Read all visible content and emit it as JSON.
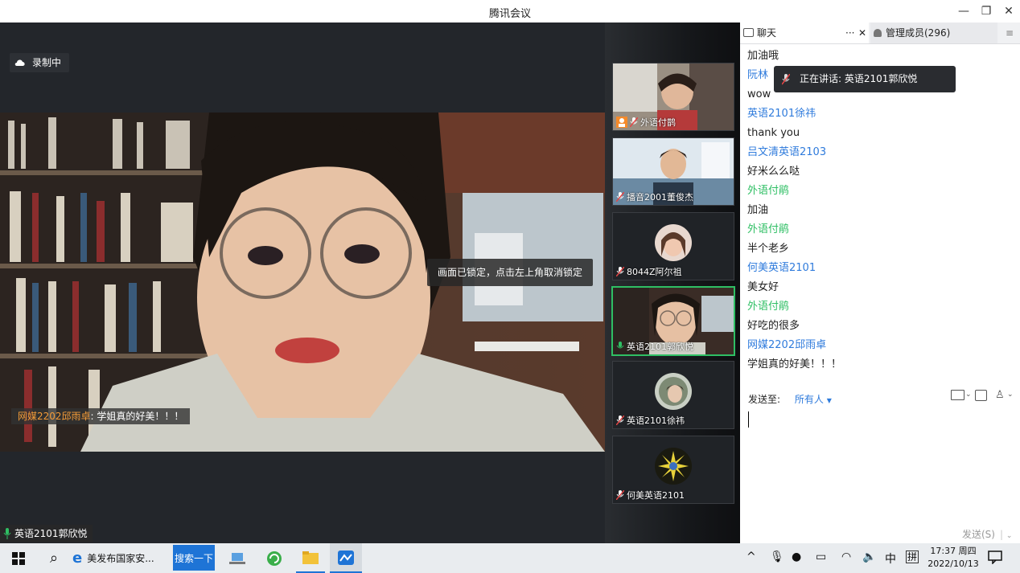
{
  "window": {
    "title": "腾讯会议"
  },
  "video": {
    "recording_label": "录制中",
    "lock_tip": "画面已锁定，点击左上角取消锁定",
    "danmu_name": "网媒2202邱雨卓",
    "danmu_sep": ": ",
    "danmu_text": "学姐真的好美！！！",
    "speaker_name": "英语2101郭欣悦"
  },
  "participants": [
    {
      "name": "外语付鹊"
    },
    {
      "name": "播音2001董俊杰"
    },
    {
      "name": "8044Z阿尔祖"
    },
    {
      "name": "英语2101郭欣悦"
    },
    {
      "name": "英语2101徐祎"
    },
    {
      "name": "何美英语2101"
    }
  ],
  "chat": {
    "tab_label": "聊天",
    "members_label": "管理成员(296)",
    "messages": [
      {
        "kind": "text",
        "value": "加油哦"
      },
      {
        "kind": "sender",
        "value": "阮林"
      },
      {
        "kind": "text",
        "value": "wow"
      },
      {
        "kind": "sender",
        "value": "英语2101徐祎"
      },
      {
        "kind": "text",
        "value": "thank you"
      },
      {
        "kind": "sender",
        "value": "吕文清英语2103"
      },
      {
        "kind": "text",
        "value": "好米么么哒"
      },
      {
        "kind": "sender-green",
        "value": "外语付鹃"
      },
      {
        "kind": "text",
        "value": "加油"
      },
      {
        "kind": "sender-green",
        "value": "外语付鹃"
      },
      {
        "kind": "text",
        "value": "半个老乡"
      },
      {
        "kind": "sender",
        "value": "何美英语2101"
      },
      {
        "kind": "text",
        "value": "美女好"
      },
      {
        "kind": "sender-green",
        "value": "外语付鹃"
      },
      {
        "kind": "text",
        "value": "好吃的很多"
      },
      {
        "kind": "sender",
        "value": "网媒2202邱雨卓"
      },
      {
        "kind": "text",
        "value": "学姐真的好美！！！"
      }
    ],
    "speaking_label": "正在讲话: 英语2101郭欣悦",
    "send_to_label": "发送至:",
    "send_to_value": "所有人",
    "send_button": "发送(S)"
  },
  "taskbar": {
    "browser_tab_label": "美发布国家安...",
    "search_button": "搜索一下",
    "time": "17:37 周四",
    "date": "2022/10/13",
    "ime_lang": "中",
    "ime_mode": "拼"
  },
  "colors": {
    "accent": "#2f7bdc",
    "active_border": "#2fbf64"
  }
}
